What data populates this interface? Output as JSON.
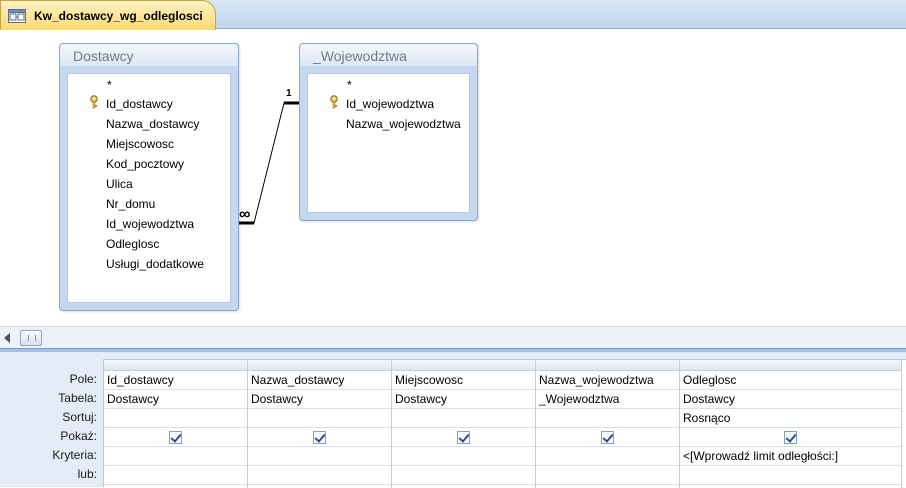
{
  "tab": {
    "label": "Kw_dostawcy_wg_odleglosci",
    "icon": "query-icon"
  },
  "tables": [
    {
      "title": "Dostawcy",
      "fields": [
        "*",
        "Id_dostawcy",
        "Nazwa_dostawcy",
        "Miejscowosc",
        "Kod_pocztowy",
        "Ulica",
        "Nr_domu",
        "Id_wojewodztwa",
        "Odleglosc",
        "Usługi_dodatkowe"
      ],
      "key_field": "Id_dostawcy"
    },
    {
      "title": "_Wojewodztwa",
      "fields": [
        "*",
        "Id_wojewodztwa",
        "Nazwa_wojewodztwa"
      ],
      "key_field": "Id_wojewodztwa"
    }
  ],
  "relationship": {
    "one_label": "1",
    "many_label": "∞"
  },
  "grid": {
    "row_labels": [
      "Pole:",
      "Tabela:",
      "Sortuj:",
      "Pokaż:",
      "Kryteria:",
      "lub:"
    ],
    "columns": [
      {
        "field": "Id_dostawcy",
        "table": "Dostawcy",
        "sort": "",
        "show": true,
        "criteria": "",
        "or": ""
      },
      {
        "field": "Nazwa_dostawcy",
        "table": "Dostawcy",
        "sort": "",
        "show": true,
        "criteria": "",
        "or": ""
      },
      {
        "field": "Miejscowosc",
        "table": "Dostawcy",
        "sort": "",
        "show": true,
        "criteria": "",
        "or": ""
      },
      {
        "field": "Nazwa_wojewodztwa",
        "table": "_Wojewodztwa",
        "sort": "",
        "show": true,
        "criteria": "",
        "or": ""
      },
      {
        "field": "Odleglosc",
        "table": "Dostawcy",
        "sort": "Rosnąco",
        "show": true,
        "criteria": "<[Wprowadź limit odległości:]",
        "or": ""
      }
    ]
  },
  "colors": {
    "tab_bg": "#ffd972",
    "pane_border": "#8fb1de",
    "table_frame": "#c5d8ef"
  }
}
